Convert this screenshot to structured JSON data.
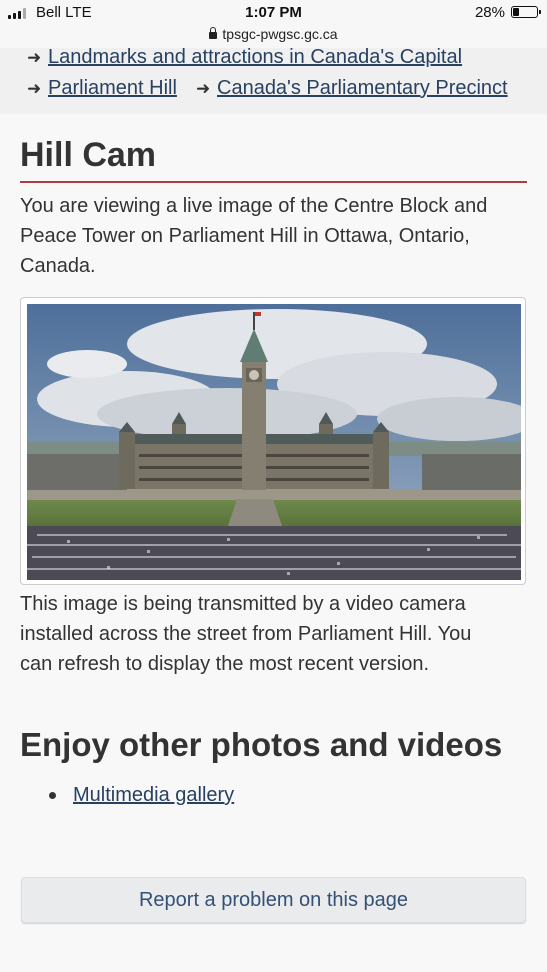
{
  "status_bar": {
    "carrier": "Bell LTE",
    "time": "1:07 PM",
    "battery_percent": "28%",
    "battery_level": 0.28
  },
  "browser": {
    "url": "tpsgc-pwgsc.gc.ca"
  },
  "breadcrumbs": {
    "items": [
      {
        "label": "Landmarks and attractions in Canada's Capital"
      },
      {
        "label": "Parliament Hill"
      },
      {
        "label": "Canada's Parliamentary Precinct"
      }
    ]
  },
  "main": {
    "title": "Hill Cam",
    "intro_lines": [
      "You are viewing a live image of the Centre Block and",
      "Peace Tower on Parliament Hill in Ottawa, Ontario,",
      "Canada."
    ],
    "caption_lines": [
      "This image is being transmitted by a video camera",
      "installed across the street from Parliament Hill. You",
      "can refresh to display the most recent version."
    ],
    "section_title": "Enjoy other photos and videos",
    "links": [
      {
        "label": "Multimedia gallery"
      }
    ]
  },
  "footer": {
    "report_label": "Report a problem on this page"
  }
}
